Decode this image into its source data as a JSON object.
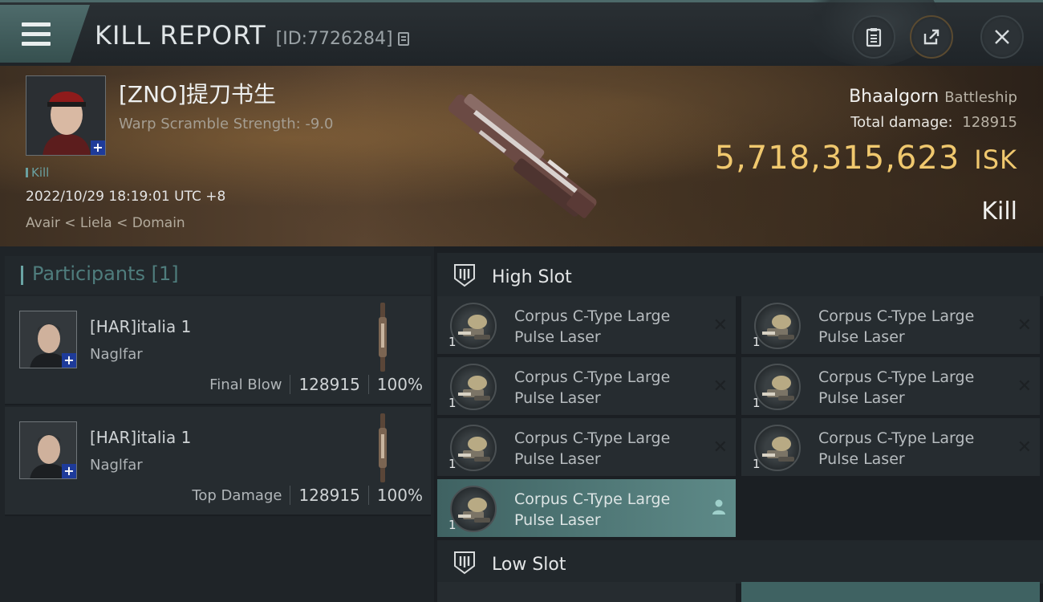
{
  "header": {
    "title": "KILL REPORT",
    "report_id": "[ID:7726284]"
  },
  "victim": {
    "name": "[ZNO]提刀书生",
    "warp_scramble": "Warp Scramble Strength: -9.0",
    "tag": "Kill",
    "datetime": "2022/10/29 18:19:01 UTC +8",
    "location": "Avair < Liela < Domain",
    "ship_name": "Bhaalgorn",
    "ship_class": "Battleship",
    "total_damage_label": "Total damage:",
    "total_damage": "128915",
    "isk_value": "5,718,315,623",
    "isk_unit": "ISK",
    "result": "Kill"
  },
  "participants": {
    "title": "Participants [1]",
    "rows": [
      {
        "name": "[HAR]italia 1",
        "ship": "Naglfar",
        "role": "Final Blow",
        "damage": "128915",
        "percent": "100%"
      },
      {
        "name": "[HAR]italia 1",
        "ship": "Naglfar",
        "role": "Top Damage",
        "damage": "128915",
        "percent": "100%"
      }
    ]
  },
  "fitting": {
    "high_slot_label": "High Slot",
    "low_slot_label": "Low Slot",
    "high_modules": [
      {
        "line1": "Corpus C-Type Large",
        "line2": "Pulse Laser",
        "qty": "1",
        "status": "destroyed-icon"
      },
      {
        "line1": "Corpus C-Type Large",
        "line2": "Pulse Laser",
        "qty": "1",
        "status": "destroyed-icon"
      },
      {
        "line1": "Corpus C-Type Large",
        "line2": "Pulse Laser",
        "qty": "1",
        "status": "destroyed-icon"
      },
      {
        "line1": "Corpus C-Type Large",
        "line2": "Pulse Laser",
        "qty": "1",
        "status": "destroyed-icon"
      },
      {
        "line1": "Corpus C-Type Large",
        "line2": "Pulse Laser",
        "qty": "1",
        "status": "destroyed-icon"
      },
      {
        "line1": "Corpus C-Type Large",
        "line2": "Pulse Laser",
        "qty": "1",
        "status": "destroyed-icon"
      },
      {
        "line1": "Corpus C-Type Large",
        "line2": "Pulse Laser",
        "qty": "1",
        "status": "dropped-user-icon"
      }
    ]
  },
  "colors": {
    "accent_teal": "#4e6b6b",
    "isk_gold": "#f0c86e",
    "selected_module": "#5e8a88"
  }
}
